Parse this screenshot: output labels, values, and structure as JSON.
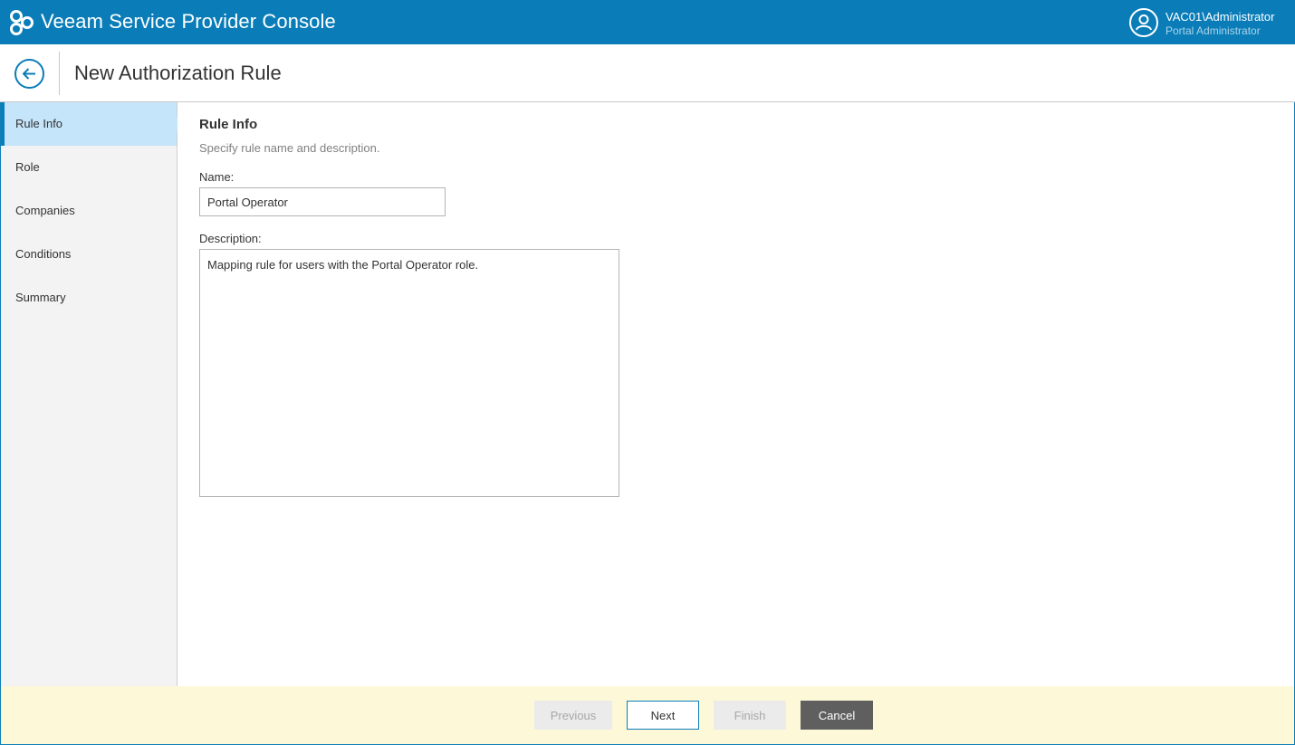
{
  "header": {
    "app_title": "Veeam Service Provider Console",
    "user_name": "VAC01\\Administrator",
    "user_role": "Portal Administrator",
    "logo_icon": "veeam-logo-icon",
    "user_icon": "user-avatar-icon"
  },
  "page": {
    "title": "New Authorization Rule",
    "back_icon": "arrow-left-icon"
  },
  "steps": [
    {
      "label": "Rule Info",
      "active": true
    },
    {
      "label": "Role",
      "active": false
    },
    {
      "label": "Companies",
      "active": false
    },
    {
      "label": "Conditions",
      "active": false
    },
    {
      "label": "Summary",
      "active": false
    }
  ],
  "form": {
    "section_title": "Rule Info",
    "section_description": "Specify rule name and description.",
    "name_label": "Name:",
    "name_value": "Portal Operator",
    "description_label": "Description:",
    "description_value": "Mapping rule for users with the Portal Operator role."
  },
  "footer": {
    "previous_label": "Previous",
    "next_label": "Next",
    "finish_label": "Finish",
    "cancel_label": "Cancel"
  },
  "colors": {
    "header_bg": "#0a7db8",
    "active_step_bg": "#c5e5fb",
    "footer_bg": "#fdf8d8",
    "cancel_bg": "#5f5f5f"
  }
}
